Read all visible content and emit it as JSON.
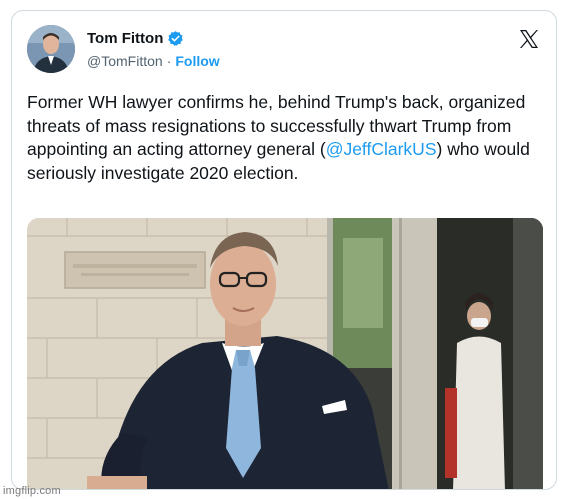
{
  "author": {
    "display_name": "Tom Fitton",
    "handle": "@TomFitton",
    "separator": "·",
    "follow_label": "Follow",
    "verified": true
  },
  "tweet": {
    "text_part1": "Former WH lawyer confirms he, behind Trump's back, organized threats of mass resignations to successfully thwart Trump from appointing an acting attorney general (",
    "mention": "@JeffClarkUS",
    "text_part2": ") who would seriously investigate 2020 election."
  },
  "icons": {
    "close": "x-logo-icon",
    "verified": "verified-badge-icon"
  },
  "colors": {
    "link": "#1d9bf0",
    "text": "#0f1419",
    "secondary": "#536471",
    "border": "#cfd9de"
  },
  "watermark": "imgflip.com"
}
